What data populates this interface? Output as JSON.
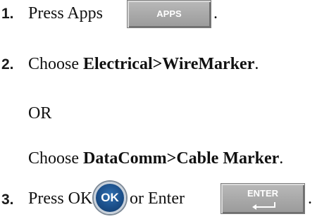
{
  "steps": [
    {
      "number": "1.",
      "text": "Press Apps",
      "key_label": "APPS"
    },
    {
      "number": "2.",
      "prefix": "Choose ",
      "bold": "Electrical>WireMarker",
      "suffix": "."
    },
    {
      "or_text": "OR"
    },
    {
      "prefix": "Choose ",
      "bold": "DataComm>Cable Marker",
      "suffix": "."
    },
    {
      "number": "3.",
      "text_a": "Press OK",
      "ok_label": "OK",
      "text_b": "or Enter",
      "enter_label": "ENTER",
      "suffix": "."
    }
  ],
  "step1_suffix": ".",
  "colors": {
    "key_bg": "#a8a8a8",
    "ok_blue": "#1b4f8a"
  }
}
